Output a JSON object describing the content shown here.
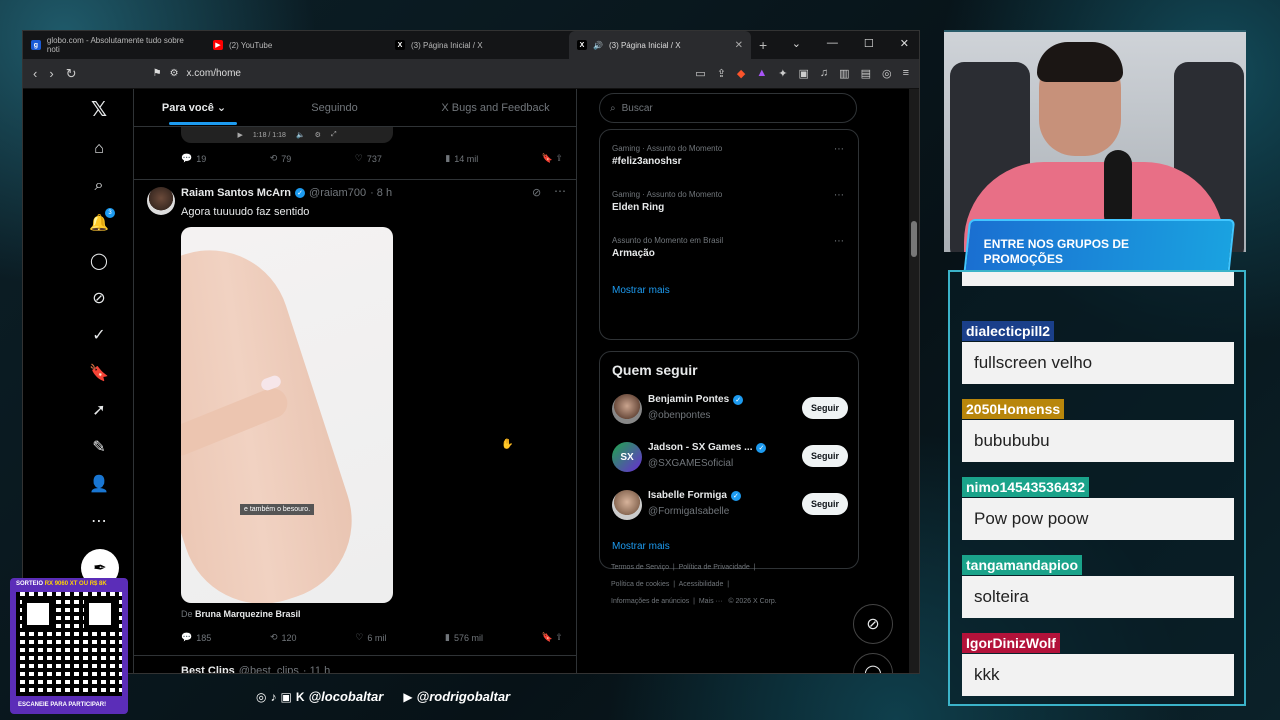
{
  "browser": {
    "tabs": [
      {
        "title": "globo.com - Absolutamente tudo sobre noti",
        "fav_color": "#1a5bd6",
        "fav": "g"
      },
      {
        "title": "(2) YouTube",
        "fav_color": "#ff0000",
        "fav": "▶"
      },
      {
        "title": "(3) Página Inicial / X",
        "fav_color": "#000000",
        "fav": "X"
      },
      {
        "title": "(3) Página Inicial / X",
        "fav_color": "#000000",
        "fav": "X"
      }
    ],
    "url": "x.com/home"
  },
  "timeline": {
    "tabs": [
      "Para você",
      "Seguindo",
      "X Bugs and Feedback"
    ],
    "video_time": "1:18 / 1:18",
    "prev_actions": {
      "replies": "19",
      "reposts": "79",
      "likes": "737",
      "views": "14 mil"
    },
    "tweet": {
      "name": "Raiam Santos McArn",
      "handle": "@raiam700",
      "time": "· 8 h",
      "text": "Agora tuuuudo faz sentido",
      "caption": "e também o besouro.",
      "from_label": "De",
      "from_name": "Bruna Marquezine Brasil",
      "actions": {
        "replies": "185",
        "reposts": "120",
        "likes": "6 mil",
        "views": "576 mil"
      }
    },
    "next_tweet": {
      "name": "Best Clips",
      "handle": "@best_clips",
      "time": "· 11 h"
    }
  },
  "nav": {
    "notif_count": "3"
  },
  "sidebar": {
    "search_placeholder": "Buscar",
    "trends": [
      {
        "context": "Gaming · Assunto do Momento",
        "name": "#feliz3anoshsr"
      },
      {
        "context": "Gaming · Assunto do Momento",
        "name": "Elden Ring"
      },
      {
        "context": "Assunto do Momento em Brasil",
        "name": "Armação"
      }
    ],
    "show_more": "Mostrar mais",
    "who_to_follow": "Quem seguir",
    "follow": [
      {
        "name": "Benjamin Pontes",
        "handle": "@obenpontes",
        "btn": "Seguir"
      },
      {
        "name": "Jadson - SX Games ...",
        "handle": "@SXGAMESoficial",
        "btn": "Seguir"
      },
      {
        "name": "Isabelle Formiga",
        "handle": "@FormigaIsabelle",
        "btn": "Seguir"
      }
    ],
    "show_more2": "Mostrar mais",
    "footer": [
      "Termos de Serviço",
      "Política de Privacidade",
      "Política de cookies",
      "Acessibilidade",
      "Informações de anúncios",
      "Mais ···",
      "© 2026 X Corp."
    ]
  },
  "stream": {
    "promo": "ENTRE NOS GRUPOS DE PROMOÇÕES",
    "chat": [
      {
        "user": "dialecticpill2",
        "color": "#1a3f8a",
        "text": "fullscreen velho"
      },
      {
        "user": "2050Homenss",
        "color": "#b8860b",
        "text": "bubububu"
      },
      {
        "user": "nimo14543536432",
        "color": "#1aa38a",
        "text": "Pow pow poow"
      },
      {
        "user": "tangamandapioo",
        "color": "#1aa38a",
        "text": "solteira"
      },
      {
        "user": "IgorDinizWolf",
        "color": "#b3123a",
        "text": "kkk"
      }
    ],
    "qr_top_prefix": "SORTEIO",
    "qr_top_highlight": "RX 9060 XT OU R$ 8K",
    "qr_bottom": "ESCANEIE PARA PARTICIPAR!",
    "social1": "@locobaltar",
    "social2": "@rodrigobaltar"
  }
}
